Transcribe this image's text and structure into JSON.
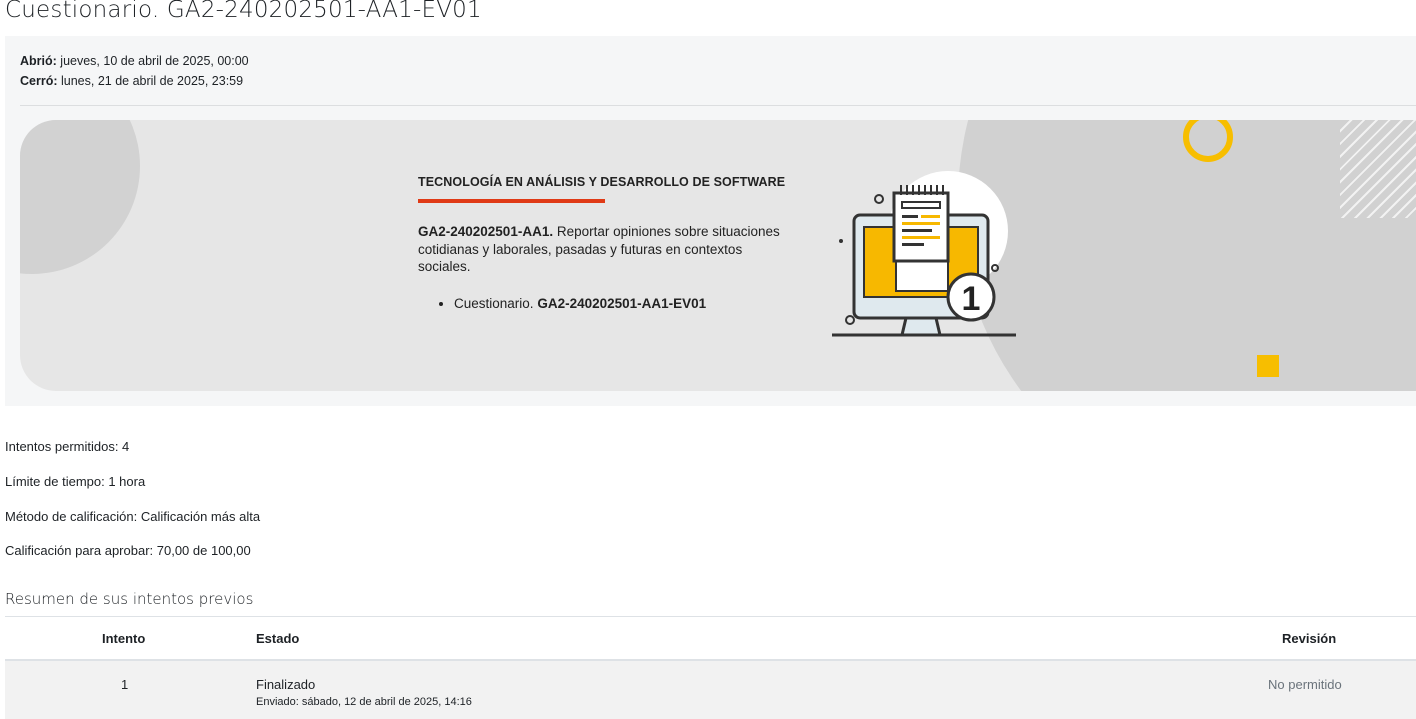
{
  "page_title": "Cuestionario. GA2-240202501-AA1-EV01",
  "dates": {
    "opened_label": "Abrió:",
    "opened_value": "jueves, 10 de abril de 2025, 00:00",
    "closed_label": "Cerró:",
    "closed_value": "lunes, 21 de abril de 2025, 23:59"
  },
  "banner": {
    "program_title": "TECNOLOGÍA EN ANÁLISIS Y DESARROLLO DE SOFTWARE",
    "activity_code": "GA2-240202501-AA1.",
    "activity_description": "Reportar opiniones sobre situaciones cotidianas y laborales, pasadas y futuras en contextos sociales.",
    "bullet_prefix": "Cuestionario.",
    "bullet_code": "GA2-240202501-AA1-EV01",
    "illustration_number": "1",
    "colors": {
      "accent_red": "#e03a16",
      "accent_yellow": "#f7be00"
    }
  },
  "quiz_info": {
    "attempts_allowed": "Intentos permitidos: 4",
    "time_limit": "Límite de tiempo: 1 hora",
    "grading_method": "Método de calificación: Calificación más alta",
    "grade_to_pass": "Calificación para aprobar: 70,00 de 100,00"
  },
  "attempts_summary": {
    "heading": "Resumen de sus intentos previos",
    "columns": [
      "Intento",
      "Estado",
      "Revisión"
    ],
    "rows": [
      {
        "attempt": "1",
        "state": "Finalizado",
        "submitted": "Enviado: sábado, 12 de abril de 2025, 14:16",
        "review": "No permitido"
      }
    ]
  }
}
